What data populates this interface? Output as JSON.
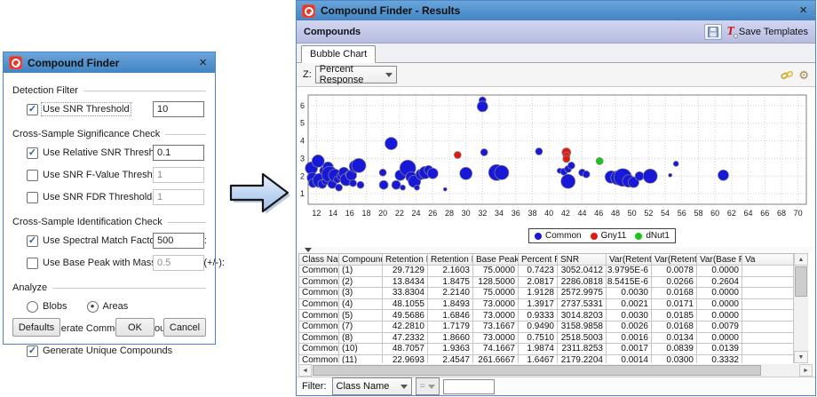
{
  "finder": {
    "title": "Compound Finder",
    "groups": [
      {
        "label": "Detection Filter"
      },
      {
        "label": "Cross-Sample Significance Check"
      },
      {
        "label": "Cross-Sample Identification Check"
      },
      {
        "label": "Analyze"
      }
    ],
    "rows": [
      {
        "check": "✓",
        "label": "Use SNR Threshold",
        "value": "10",
        "enabled": true
      },
      {
        "check": "✓",
        "label": "Use Relative SNR Threshold:",
        "value": "0.1",
        "enabled": true
      },
      {
        "check": "",
        "label": "Use SNR F-Value Threshold:",
        "value": "1",
        "enabled": false
      },
      {
        "check": "",
        "label": "Use SNR FDR Threshold:",
        "value": "1",
        "enabled": false
      },
      {
        "check": "✓",
        "label": "Use Spectral Match Factor Threshold:",
        "value": "500",
        "enabled": true
      },
      {
        "check": "",
        "label": "Use Base Peak with Mass Tolerance (+/-):",
        "value": "0.5",
        "enabled": false
      }
    ],
    "analyze": {
      "radios": [
        {
          "label": "Blobs",
          "dot": ""
        },
        {
          "label": "Areas",
          "dot": "●"
        }
      ],
      "checks": [
        {
          "check": "✓",
          "label": "Generate Common Compounds"
        },
        {
          "check": "✓",
          "label": "Generate Unique Compounds"
        }
      ]
    },
    "buttons": {
      "defaults": "Defaults",
      "ok": "OK",
      "cancel": "Cancel"
    },
    "close_glyph": "×"
  },
  "results": {
    "title": "Compound Finder - Results",
    "panel_title": "Compounds",
    "save_templates_label": "Save Templates",
    "template_icon_glyph": "T",
    "gear_glyph": "⚙",
    "tab": "Bubble Chart",
    "z_label": "Z:",
    "z_value": "Percent Response",
    "filter": {
      "label": "Filter:",
      "field": "Class Name",
      "operator": "=",
      "value": ""
    },
    "close_glyph": "×"
  },
  "chart_data": {
    "type": "bubble",
    "title": "",
    "xlabel": "",
    "ylabel": "",
    "xlim": [
      11,
      71
    ],
    "ylim": [
      0.4,
      6.6
    ],
    "x_ticks": [
      12,
      14,
      16,
      18,
      20,
      22,
      24,
      26,
      28,
      30,
      32,
      34,
      36,
      38,
      40,
      42,
      44,
      46,
      48,
      50,
      52,
      54,
      56,
      58,
      60,
      62,
      64,
      66,
      68,
      70
    ],
    "y_ticks": [
      1,
      2,
      3,
      4,
      5,
      6
    ],
    "grid": "dotted",
    "legend_position": "bottom",
    "z_dimension": "Percent Response",
    "series": [
      {
        "name": "Common",
        "color": "#1818d8",
        "points": [
          [
            11.4,
            2.45,
            7
          ],
          [
            11.5,
            1.9,
            6
          ],
          [
            11.6,
            1.6,
            5
          ],
          [
            12.2,
            2.85,
            7
          ],
          [
            12.4,
            1.75,
            8
          ],
          [
            12.7,
            1.55,
            5
          ],
          [
            12.9,
            2.3,
            5
          ],
          [
            13.1,
            1.7,
            4
          ],
          [
            13.4,
            2.5,
            6
          ],
          [
            13.6,
            2.1,
            9
          ],
          [
            13.9,
            1.55,
            5
          ],
          [
            14.2,
            2.05,
            7
          ],
          [
            14.5,
            1.8,
            4
          ],
          [
            14.7,
            1.35,
            4
          ],
          [
            15.0,
            2.0,
            5
          ],
          [
            15.3,
            2.2,
            6
          ],
          [
            15.6,
            1.8,
            7
          ],
          [
            15.9,
            2.1,
            4
          ],
          [
            16.2,
            2.05,
            6
          ],
          [
            16.4,
            1.6,
            4
          ],
          [
            16.7,
            2.55,
            7
          ],
          [
            17.1,
            2.6,
            8
          ],
          [
            17.3,
            1.5,
            4
          ],
          [
            20.0,
            2.2,
            4
          ],
          [
            20.1,
            1.5,
            5
          ],
          [
            21.0,
            3.85,
            7
          ],
          [
            21.6,
            1.5,
            5
          ],
          [
            22.1,
            2.05,
            6
          ],
          [
            22.4,
            1.35,
            3
          ],
          [
            23.0,
            2.45,
            9
          ],
          [
            23.4,
            1.95,
            6
          ],
          [
            23.8,
            1.7,
            7
          ],
          [
            24.1,
            1.35,
            3
          ],
          [
            24.6,
            2.1,
            6
          ],
          [
            25.1,
            2.2,
            7
          ],
          [
            25.5,
            2.35,
            5
          ],
          [
            26.0,
            2.15,
            6
          ],
          [
            27.5,
            1.25,
            2
          ],
          [
            30.0,
            2.15,
            7
          ],
          [
            32.0,
            6.3,
            4
          ],
          [
            32.0,
            5.95,
            6
          ],
          [
            32.2,
            3.35,
            4
          ],
          [
            33.7,
            2.2,
            9
          ],
          [
            34.3,
            2.2,
            8
          ],
          [
            38.8,
            3.4,
            4
          ],
          [
            41.3,
            2.3,
            3
          ],
          [
            41.8,
            2.25,
            4
          ],
          [
            42.3,
            2.4,
            4
          ],
          [
            42.7,
            2.6,
            4
          ],
          [
            42.3,
            1.7,
            8
          ],
          [
            44.0,
            2.2,
            4
          ],
          [
            44.5,
            2.1,
            4
          ],
          [
            47.5,
            1.95,
            7
          ],
          [
            48.3,
            1.9,
            8
          ],
          [
            48.9,
            1.92,
            10
          ],
          [
            49.6,
            1.72,
            7
          ],
          [
            50.2,
            1.65,
            6
          ],
          [
            50.9,
            2.0,
            5
          ],
          [
            52.2,
            2.0,
            8
          ],
          [
            54.6,
            2.05,
            2
          ],
          [
            55.3,
            2.7,
            3
          ],
          [
            61.0,
            2.05,
            6
          ]
        ]
      },
      {
        "name": "Gny11",
        "color": "#e01b0e",
        "points": [
          [
            29.0,
            3.2,
            4
          ],
          [
            42.1,
            3.35,
            5
          ],
          [
            42.1,
            3.15,
            4
          ],
          [
            42.1,
            2.97,
            4
          ]
        ]
      },
      {
        "name": "dNut1",
        "color": "#17c617",
        "points": [
          [
            46.1,
            2.85,
            4
          ]
        ]
      }
    ]
  },
  "table": {
    "columns": [
      "Class Name",
      "Compound...",
      "Retention I",
      "Retention II",
      "Base Peak",
      "Percent Re...",
      "SNR",
      "Var(Retent...",
      "Var(Retent...",
      "Var(Base P...",
      "Va"
    ],
    "rows": [
      [
        "Common",
        "(1)",
        "29.7129",
        "2.1603",
        "75.0000",
        "0.7423",
        "3052.0412",
        "3.9795E-6",
        "0.0078",
        "0.0000",
        ""
      ],
      [
        "Common",
        "(2)",
        "13.8434",
        "1.8475",
        "128.5000",
        "2.0817",
        "2286.0818",
        "8.5415E-6",
        "0.0266",
        "0.2604",
        ""
      ],
      [
        "Common",
        "(3)",
        "33.8304",
        "2.2140",
        "75.0000",
        "1.9128",
        "2572.9975",
        "0.0030",
        "0.0168",
        "0.0000",
        ""
      ],
      [
        "Common",
        "(4)",
        "48.1055",
        "1.8493",
        "73.0000",
        "1.3917",
        "2737.5331",
        "0.0021",
        "0.0171",
        "0.0000",
        ""
      ],
      [
        "Common",
        "(5)",
        "49.5686",
        "1.6846",
        "73.0000",
        "0.9333",
        "3014.8203",
        "0.0030",
        "0.0185",
        "0.0000",
        ""
      ],
      [
        "Common",
        "(7)",
        "42.2810",
        "1.7179",
        "73.1667",
        "0.9490",
        "3158.9858",
        "0.0026",
        "0.0168",
        "0.0079",
        ""
      ],
      [
        "Common",
        "(8)",
        "47.2332",
        "1.8660",
        "73.0000",
        "0.7510",
        "2518.5003",
        "0.0016",
        "0.0134",
        "0.0000",
        ""
      ],
      [
        "Common",
        "(10)",
        "48.7057",
        "1.9363",
        "74.1667",
        "1.9874",
        "2311.8253",
        "0.0017",
        "0.0839",
        "0.0139",
        ""
      ],
      [
        "Common",
        "(11)",
        "22.9693",
        "2.4547",
        "261.6667",
        "1.6467",
        "2179.2204",
        "0.0014",
        "0.0300",
        "0.3332",
        ""
      ]
    ]
  },
  "colors": {
    "titlebar_blue": "#4184c4",
    "band_lavender": "#bfc4e4",
    "window_border": "#4a86c8",
    "bubble_common": "#1818d8",
    "bubble_gny11": "#e01b0e",
    "bubble_dnut1": "#17c617"
  }
}
